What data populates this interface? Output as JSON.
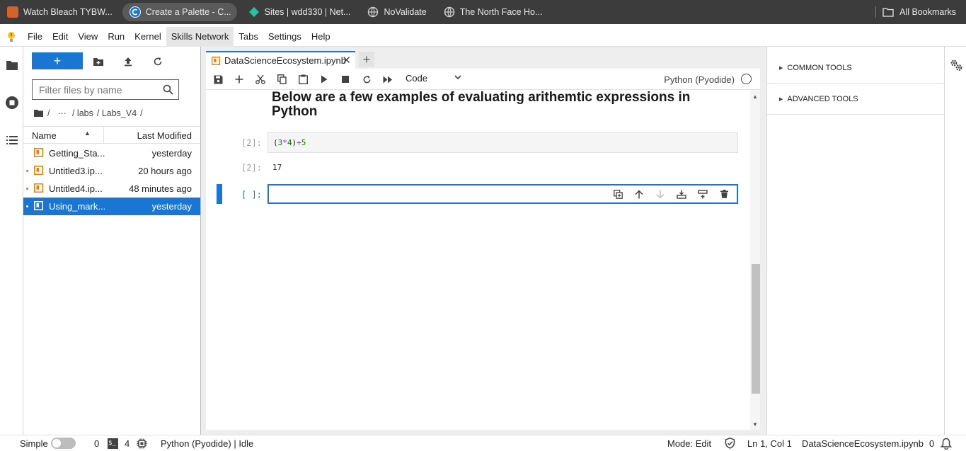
{
  "browser": {
    "bookmarks": [
      {
        "label": "Watch Bleach TYBW...",
        "icon": "anime-favicon-icon",
        "color": "#d4622a"
      },
      {
        "label": "Create a Palette - C...",
        "icon": "palette-favicon-icon",
        "color": "#1976d2"
      },
      {
        "label": "Sites | wdd330 | Net...",
        "icon": "netlify-favicon-icon",
        "color": "#25c2a0"
      },
      {
        "label": "NoValidate",
        "icon": "globe-icon",
        "color": "#cccccc"
      },
      {
        "label": "The North Face Ho...",
        "icon": "globe-icon",
        "color": "#cccccc"
      }
    ],
    "all_bookmarks": "All Bookmarks"
  },
  "menu": {
    "items": [
      "File",
      "Edit",
      "View",
      "Run",
      "Kernel",
      "Skills Network",
      "Tabs",
      "Settings",
      "Help"
    ],
    "highlighted": "Skills Network"
  },
  "filebrowser": {
    "new_label": "+",
    "filter_placeholder": "Filter files by name",
    "breadcrumbs": [
      "/",
      "···",
      "/ labs",
      "/ Labs_V4",
      "/"
    ],
    "col_name": "Name",
    "col_modified": "Last Modified",
    "files": [
      {
        "name": "Getting_Sta...",
        "modified": "yesterday",
        "running": false,
        "selected": false
      },
      {
        "name": "Untitled3.ip...",
        "modified": "20 hours ago",
        "running": true,
        "selected": false
      },
      {
        "name": "Untitled4.ip...",
        "modified": "48 minutes ago",
        "running": true,
        "selected": false
      },
      {
        "name": "Using_mark...",
        "modified": "yesterday",
        "running": true,
        "selected": true
      }
    ]
  },
  "notebook": {
    "tab_title": "DataScienceEcosystem.ipynb",
    "close_glyph": "✕",
    "add_tab": "+",
    "cell_type": "Code",
    "kernel": "Python (Pyodide)",
    "heading_line1": "Below are a few examples of evaluating arithemtic expressions in",
    "heading_line2": "Python",
    "cell1_prompt": "[2]:",
    "cell1_code": {
      "p1": "(",
      "n1": "3",
      "op1": "*",
      "n2": "4",
      "p2": ")",
      "op2": "+",
      "n3": "5"
    },
    "out1_prompt": "[2]:",
    "out1_text": "17",
    "cell2_prompt": "[ ]:",
    "cell2_value": ""
  },
  "rightpanel": {
    "common_tools": "COMMON TOOLS",
    "advanced_tools": "ADVANCED TOOLS"
  },
  "status": {
    "mode_label": "Simple",
    "terminals": "0",
    "kernels": "4",
    "kernel_status": "Python (Pyodide) | Idle",
    "mode": "Mode: Edit",
    "position": "Ln 1, Col 1",
    "filename": "DataScienceEcosystem.ipynb",
    "notifications": "0"
  },
  "colors": {
    "accent": "#1976d2",
    "notebook_icon": "#f57c00"
  }
}
